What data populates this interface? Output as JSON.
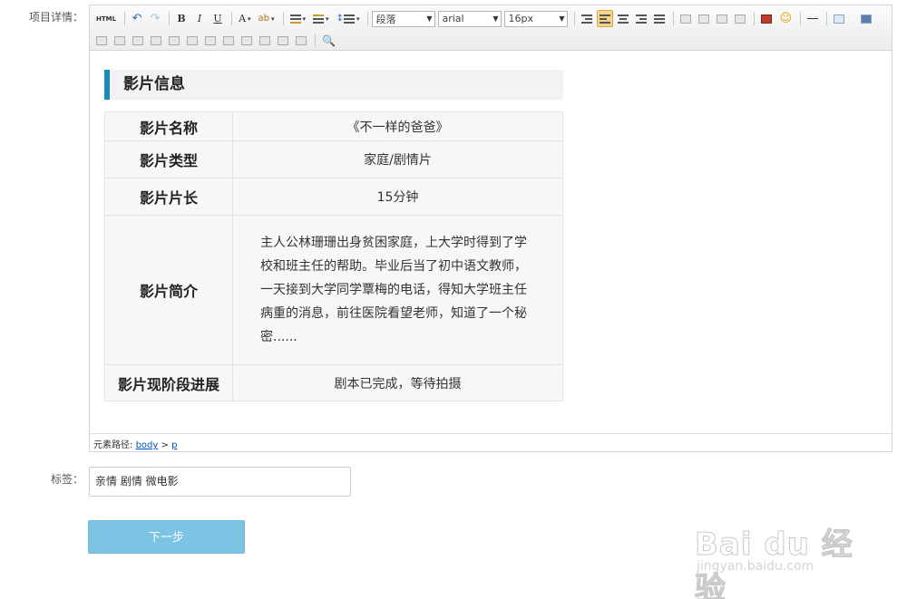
{
  "form": {
    "details_label": "项目详情：",
    "tags_label": "标签：",
    "tags_value": "亲情 剧情 微电影",
    "next_button": "下一步"
  },
  "toolbar": {
    "html_label": "HTML",
    "bold": "B",
    "italic": "I",
    "underline": "U",
    "font_color": "A",
    "paragraph_select": "段落",
    "font_family_select": "arial",
    "font_size_select": "16px"
  },
  "content": {
    "section_title": "影片信息",
    "rows": [
      {
        "key": "影片名称",
        "value": "《不一样的爸爸》"
      },
      {
        "key": "影片类型",
        "value": "家庭/剧情片"
      },
      {
        "key": "影片片长",
        "value": "15分钟"
      },
      {
        "key": "影片简介",
        "value": "主人公林珊珊出身贫困家庭，上大学时得到了学校和班主任的帮助。毕业后当了初中语文教师，一天接到大学同学覃梅的电话，得知大学班主任病重的消息，前往医院看望老师，知道了一个秘密......"
      },
      {
        "key": "影片现阶段进展",
        "value": "剧本已完成，等待拍摄"
      }
    ]
  },
  "statusbar": {
    "path_label": "元素路径:",
    "path_body": "body",
    "path_sep": ">",
    "path_p": "p"
  },
  "watermark": {
    "main": "Bai du 经验",
    "sub": "jingyan.baidu.com"
  },
  "colors": {
    "accent_bar": "#1a8bb9",
    "next_button_bg": "#7dc3e3",
    "active_tool": "#f4d48a"
  }
}
